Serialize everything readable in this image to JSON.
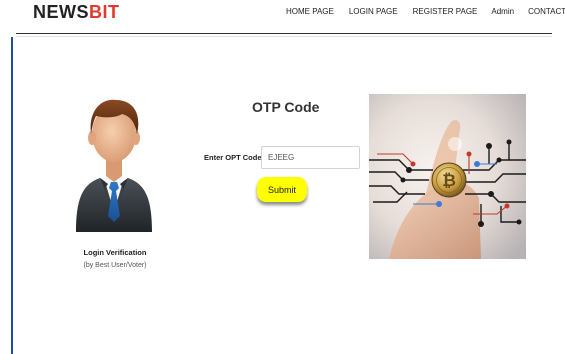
{
  "header": {
    "logo_main": "NEWS",
    "logo_accent": "BIT",
    "nav": [
      "HOME PAGE",
      "LOGIN PAGE",
      "REGISTER PAGE",
      "Admin",
      "CONTACT"
    ]
  },
  "verification": {
    "title": "Login Verification",
    "subtitle": "(by Best User/Voter)"
  },
  "otp": {
    "heading": "OTP Code",
    "label": "Enter OPT Code",
    "value": "EJEEG",
    "submit": "Submit"
  },
  "colors": {
    "accent": "#e03a2f",
    "submit_bg": "#ffff00",
    "border": "#1f4f9e"
  },
  "icons": {
    "avatar": "businessman-avatar-icon",
    "photo": "bitcoin-circuit-image"
  }
}
